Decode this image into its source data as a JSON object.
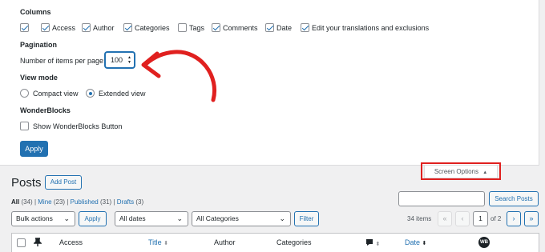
{
  "screen_options": {
    "columns": {
      "title": "Columns",
      "items": [
        {
          "label": "",
          "checked": true
        },
        {
          "label": "Access",
          "checked": true
        },
        {
          "label": "Author",
          "checked": true
        },
        {
          "label": "Categories",
          "checked": true
        },
        {
          "label": "Tags",
          "checked": false
        },
        {
          "label": "Comments",
          "checked": true
        },
        {
          "label": "Date",
          "checked": true
        },
        {
          "label": "Edit your translations and exclusions",
          "checked": true
        }
      ]
    },
    "pagination": {
      "title": "Pagination",
      "label": "Number of items per page:",
      "value": "100"
    },
    "view_mode": {
      "title": "View mode",
      "options": [
        {
          "label": "Compact view",
          "selected": false
        },
        {
          "label": "Extended view",
          "selected": true
        }
      ]
    },
    "wonderblocks": {
      "title": "WonderBlocks",
      "option": {
        "label": "Show WonderBlocks Button",
        "checked": false
      }
    },
    "apply_label": "Apply",
    "tab_label": "Screen Options",
    "tab_arrow": "▲"
  },
  "page": {
    "title": "Posts",
    "add_new_label": "Add Post"
  },
  "views": {
    "all": {
      "label": "All",
      "count": "(34)"
    },
    "mine": {
      "label": "Mine",
      "count": "(23)"
    },
    "published": {
      "label": "Published",
      "count": "(31)"
    },
    "drafts": {
      "label": "Drafts",
      "count": "(3)"
    },
    "separator": "|"
  },
  "search": {
    "value": "",
    "button_label": "Search Posts"
  },
  "tablenav": {
    "bulk_actions": "Bulk actions",
    "apply_label": "Apply",
    "dates": "All dates",
    "categories": "All Categories",
    "filter_label": "Filter",
    "items_count": "34 items",
    "first": "«",
    "prev": "‹",
    "current_page": "1",
    "of_pages": "of 2",
    "next": "›",
    "last": "»"
  },
  "table": {
    "columns": {
      "access": "Access",
      "title": "Title",
      "author": "Author",
      "categories": "Categories",
      "date": "Date"
    }
  },
  "annotations": {
    "highlight_color": "#e0201f"
  },
  "colors": {
    "accent": "#2271b1",
    "background": "#f0f0f1"
  }
}
